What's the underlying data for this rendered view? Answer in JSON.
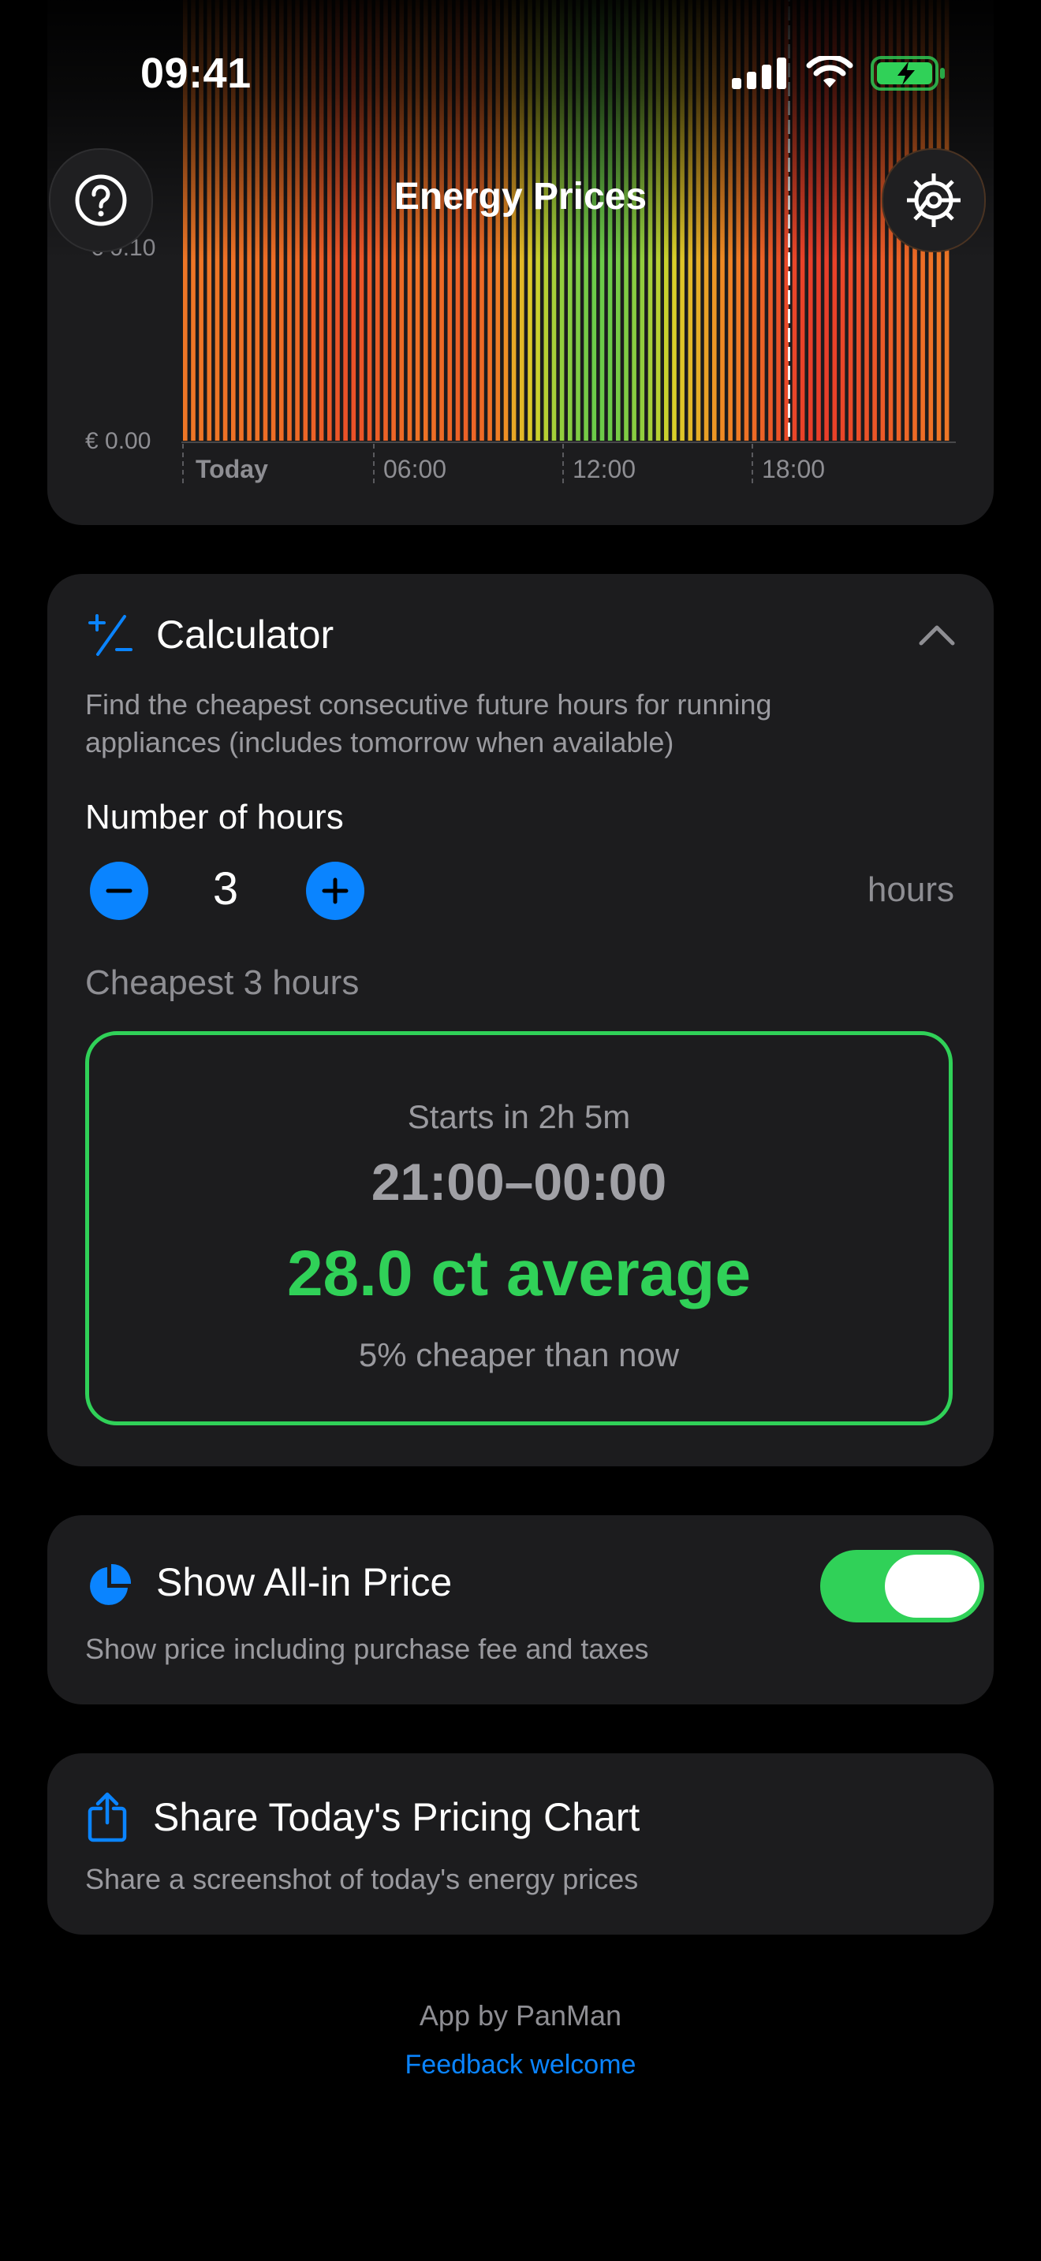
{
  "status_bar": {
    "time": "09:41"
  },
  "header": {
    "title": "Energy Prices",
    "help_icon": "question-circle-icon",
    "settings_icon": "gear-icon"
  },
  "chart": {
    "y_labels": [
      "€ 0.10",
      "€ 0.00"
    ],
    "x_labels": [
      "Today",
      "06:00",
      "12:00",
      "18:00"
    ]
  },
  "chart_data": {
    "type": "bar",
    "title": "",
    "xlabel": "",
    "ylabel": "",
    "y_ticks": [
      "€ 0.00",
      "€ 0.10"
    ],
    "x_ticks": [
      "Today",
      "06:00",
      "12:00",
      "18:00"
    ],
    "bar_count": 96,
    "current_time_marker": "~18:45",
    "colors": {
      "expensive": "#e83a2a",
      "moderate": "#f08a24",
      "cheap": "#34c759",
      "mid": "#d8d22a"
    },
    "series": [
      {
        "values_relative_cost": [
          0.7,
          0.7,
          0.7,
          0.7,
          0.7,
          0.72,
          0.72,
          0.72,
          0.72,
          0.72,
          0.74,
          0.74,
          0.74,
          0.76,
          0.76,
          0.78,
          0.8,
          0.82,
          0.84,
          0.86,
          0.88,
          0.88,
          0.86,
          0.84,
          0.82,
          0.8,
          0.78,
          0.76,
          0.74,
          0.72,
          0.72,
          0.74,
          0.76,
          0.78,
          0.8,
          0.8,
          0.78,
          0.76,
          0.72,
          0.66,
          0.58,
          0.5,
          0.44,
          0.38,
          0.32,
          0.28,
          0.24,
          0.2,
          0.18,
          0.16,
          0.14,
          0.12,
          0.12,
          0.12,
          0.14,
          0.16,
          0.18,
          0.2,
          0.24,
          0.28,
          0.32,
          0.36,
          0.4,
          0.44,
          0.48,
          0.52,
          0.56,
          0.6,
          0.64,
          0.68,
          0.72,
          0.76,
          0.8,
          0.84,
          0.88,
          0.92,
          0.94,
          0.96,
          0.98,
          0.98,
          0.98,
          0.96,
          0.94,
          0.92,
          0.9,
          0.88,
          0.86,
          0.84,
          0.82,
          0.8,
          0.78,
          0.76,
          0.74,
          0.72,
          0.7,
          0.7
        ]
      }
    ]
  },
  "calculator": {
    "title": "Calculator",
    "icon": "plus-minus-icon",
    "collapse_icon": "chevron-up-icon",
    "description_line1": "Find the cheapest consecutive future hours for running",
    "description_line2": "appliances (includes tomorrow when available)",
    "number_label": "Number of hours",
    "hours_value": "3",
    "hours_unit": "hours",
    "cheapest_label": "Cheapest 3 hours",
    "result": {
      "starts": "Starts in 2h 5m",
      "range": "21:00–00:00",
      "price": "28.0 ct average",
      "compare": "5% cheaper than now"
    }
  },
  "all_in": {
    "title": "Show All-in Price",
    "icon": "pie-chart-icon",
    "description": "Show price including purchase fee and taxes",
    "enabled": true
  },
  "share": {
    "title": "Share Today's Pricing Chart",
    "icon": "share-icon",
    "description": "Share a screenshot of today's energy prices"
  },
  "footer": {
    "by": "App by PanMan",
    "feedback": "Feedback welcome"
  }
}
